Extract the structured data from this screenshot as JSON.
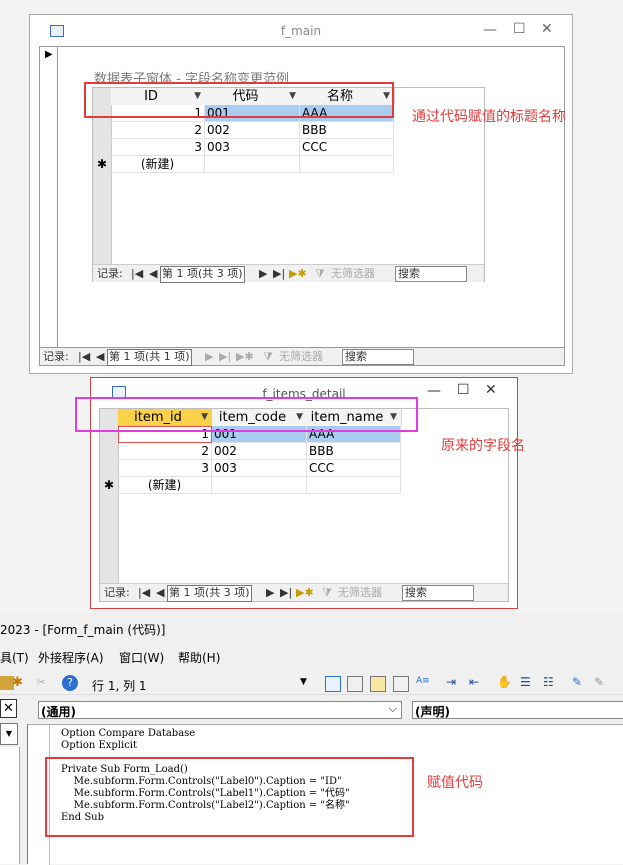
{
  "main_window": {
    "title": "f_main",
    "minimize_icon": "—",
    "maximize_icon": "☐",
    "close_icon": "✕",
    "record_selector": "▶",
    "subform_label": "数据表子窗体 - 字段名称变更范例",
    "navigation": {
      "label": "记录:",
      "current": "第 1 项(共 1 项)",
      "filter": "无筛选器",
      "search": "搜索"
    }
  },
  "subform1": {
    "columns": [
      "ID",
      "代码",
      "名称"
    ],
    "rows": [
      {
        "id": "1",
        "code": "001",
        "name": "AAA"
      },
      {
        "id": "2",
        "code": "002",
        "name": "BBB"
      },
      {
        "id": "3",
        "code": "003",
        "name": "CCC"
      }
    ],
    "new_marker": "✱",
    "new_label": "(新建)",
    "navigation": {
      "label": "记录:",
      "current": "第 1 项(共 3 项)",
      "filter": "无筛选器",
      "search": "搜索"
    }
  },
  "detail_window": {
    "title": "f_items_detail",
    "columns": [
      "item_id",
      "item_code",
      "item_name"
    ],
    "rows": [
      {
        "id": "1",
        "code": "001",
        "name": "AAA"
      },
      {
        "id": "2",
        "code": "002",
        "name": "BBB"
      },
      {
        "id": "3",
        "code": "003",
        "name": "CCC"
      }
    ],
    "new_marker": "✱",
    "new_label": "(新建)",
    "navigation": {
      "label": "记录:",
      "current": "第 1 项(共 3 项)",
      "filter": "无筛选器",
      "search": "搜索"
    }
  },
  "annotations": {
    "caption_by_code": "通过代码赋值的标题名称",
    "original_fields": "原来的字段名",
    "assign_code": "赋值代码"
  },
  "vba": {
    "title": "2023 - [Form_f_main (代码)]",
    "menu": [
      "具(T)",
      "外接程序(A)",
      "窗口(W)",
      "帮助(H)"
    ],
    "position": "行 1, 列 1",
    "object_combo": "(通用)",
    "proc_combo": "(声明)",
    "code_lines": [
      "Option Compare Database",
      "Option Explicit",
      "",
      "Private Sub Form_Load()",
      "    Me.subform.Form.Controls(\"Label0\").Caption = \"ID\"",
      "    Me.subform.Form.Controls(\"Label1\").Caption = \"代码\"",
      "    Me.subform.Form.Controls(\"Label2\").Caption = \"名称\"",
      "End Sub"
    ]
  },
  "colors": {
    "annotation": "#e23b3b",
    "magenta": "#e03ce0",
    "selection": "#a9cdf0",
    "header_highlight": "#f9d24a"
  }
}
